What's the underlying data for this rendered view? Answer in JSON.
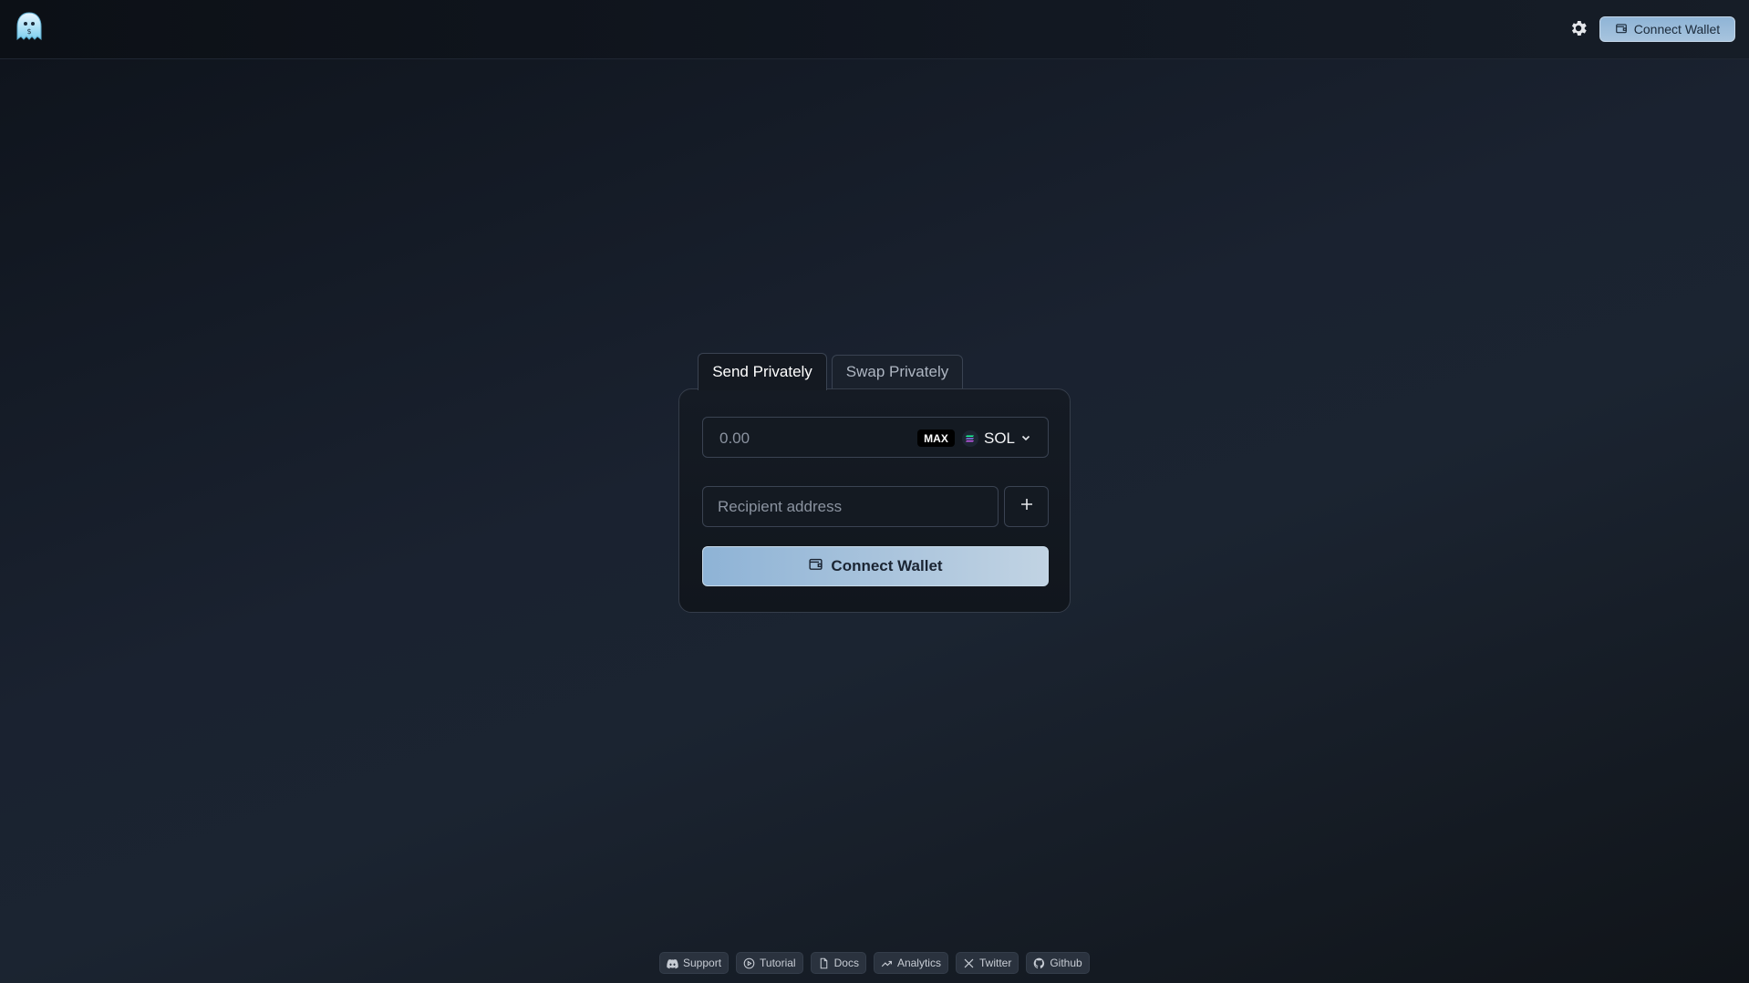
{
  "header": {
    "logo_icon": "ghost-logo-icon",
    "settings_icon": "gear-icon",
    "connect_label": "Connect Wallet"
  },
  "tabs": [
    {
      "label": "Send Privately",
      "active": true
    },
    {
      "label": "Swap Privately",
      "active": false
    }
  ],
  "form": {
    "amount_placeholder": "0.00",
    "max_label": "MAX",
    "token": "SOL",
    "recipient_placeholder": "Recipient address",
    "add_icon": "plus-icon",
    "connect_label": "Connect Wallet"
  },
  "footer": {
    "links": [
      {
        "label": "Support",
        "icon": "discord-icon"
      },
      {
        "label": "Tutorial",
        "icon": "play-icon"
      },
      {
        "label": "Docs",
        "icon": "document-icon"
      },
      {
        "label": "Analytics",
        "icon": "trend-icon"
      },
      {
        "label": "Twitter",
        "icon": "x-icon"
      },
      {
        "label": "Github",
        "icon": "github-icon"
      }
    ]
  },
  "colors": {
    "accent": "#a7c4de",
    "background": "#1a2230"
  }
}
